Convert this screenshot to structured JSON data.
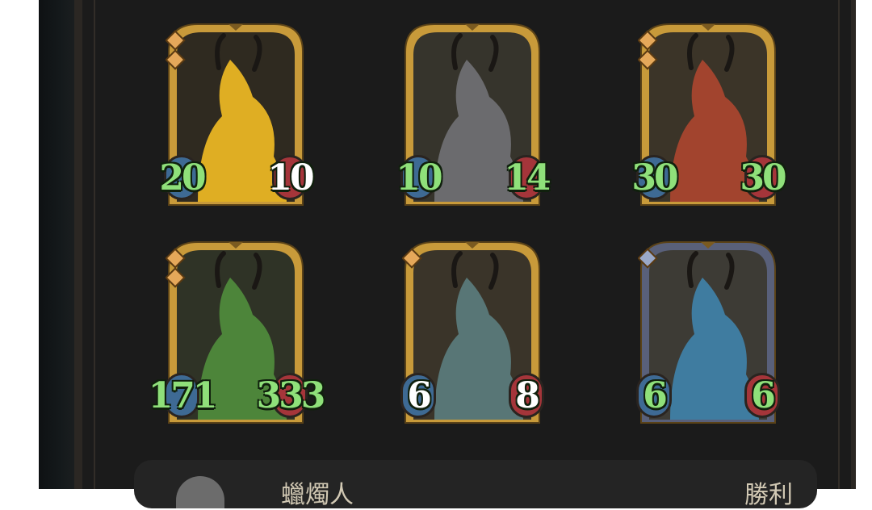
{
  "cards": [
    {
      "id": "gold-dragon",
      "atk": "20",
      "hp": "10",
      "atk_color": "#8fe07a",
      "hp_color": "#ffffff",
      "frame": "#c89a3a",
      "bg": "#2f2a20",
      "figure": "#e9b524",
      "gems": 2
    },
    {
      "id": "gray-dragon",
      "atk": "10",
      "hp": "14",
      "atk_color": "#8fe07a",
      "hp_color": "#8fe07a",
      "frame": "#c89a3a",
      "bg": "#36342c",
      "figure": "#6f6f72",
      "gems": 0
    },
    {
      "id": "red-dragon",
      "atk": "30",
      "hp": "30",
      "atk_color": "#8fe07a",
      "hp_color": "#8fe07a",
      "frame": "#c89a3a",
      "bg": "#3b3428",
      "figure": "#a8462e",
      "gems": 2
    },
    {
      "id": "green-dragon",
      "atk": "171",
      "hp": "333",
      "atk_color": "#8fe07a",
      "hp_color": "#8fe07a",
      "frame": "#c89a3a",
      "bg": "#2f3326",
      "figure": "#4f8a3b",
      "gems": 2
    },
    {
      "id": "serpent-dragon",
      "atk": "6",
      "hp": "8",
      "atk_color": "#ffffff",
      "hp_color": "#ffffff",
      "frame": "#c89a3a",
      "bg": "#3a3429",
      "figure": "#5a7a7a",
      "gems": 1
    },
    {
      "id": "blue-dragon",
      "atk": "6",
      "hp": "6",
      "atk_color": "#8fe07a",
      "hp_color": "#8fe07a",
      "frame": "#59607a",
      "bg": "#3d3b35",
      "figure": "#3f7fa6",
      "gems": 1
    }
  ],
  "bottom": {
    "player_name": "蠟燭人",
    "result": "勝利"
  }
}
